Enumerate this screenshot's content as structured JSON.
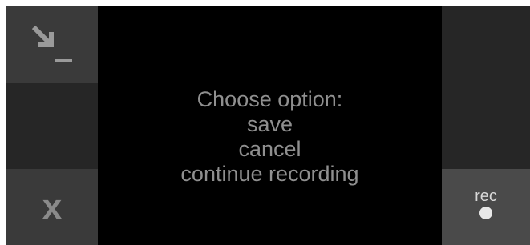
{
  "dialog": {
    "title": "Choose option:",
    "options": [
      "save",
      "cancel",
      "continue recording"
    ]
  },
  "left_panel": {
    "top_icon": "minimize-arrow-icon",
    "bottom_icon": "close-icon",
    "close_glyph": "x"
  },
  "right_panel": {
    "rec_label": "rec",
    "rec_icon": "record-dot-icon"
  },
  "colors": {
    "screen_bg": "#000000",
    "button_light": "#3a3a3a",
    "button_dark": "#262626",
    "rec_button": "#4a4a4a",
    "prompt_text": "#8f8f8f"
  }
}
